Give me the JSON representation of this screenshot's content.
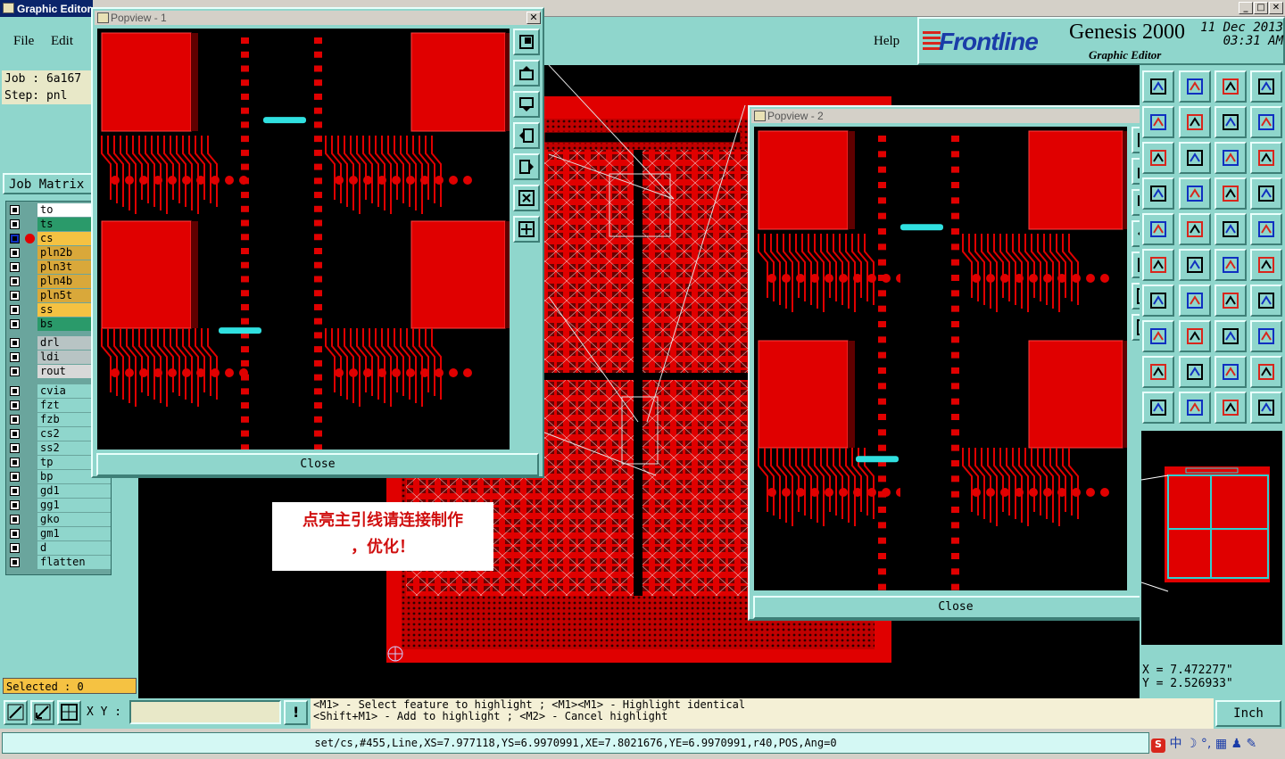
{
  "window": {
    "title": "Graphic Editor"
  },
  "menu": {
    "items": [
      "File",
      "Edit"
    ],
    "help": "Help"
  },
  "brand": {
    "logo": "Frontline",
    "product": "Genesis 2000",
    "subtitle": "Graphic Editor",
    "date": "11 Dec 2013",
    "time": "03:31 AM"
  },
  "job": {
    "job_label": "Job : 6a167",
    "step_label": "Step: pnl",
    "matrix_button": "Job Matrix"
  },
  "layers": [
    {
      "name": "to",
      "color": "#ffffff"
    },
    {
      "name": "ts",
      "color": "#2a9a6a"
    },
    {
      "name": "cs",
      "color": "#f5c242",
      "active": true
    },
    {
      "name": "pln2b",
      "color": "#d9a83a"
    },
    {
      "name": "pln3t",
      "color": "#d9a83a"
    },
    {
      "name": "pln4b",
      "color": "#d9a83a"
    },
    {
      "name": "pln5t",
      "color": "#d9a83a"
    },
    {
      "name": "ss",
      "color": "#f5c242"
    },
    {
      "name": "bs",
      "color": "#2a9a6a"
    },
    {
      "name": "drl",
      "color": "#b8c4c4"
    },
    {
      "name": "ldi",
      "color": "#b8c4c4"
    },
    {
      "name": "rout",
      "color": "#d8d8d8"
    },
    {
      "name": "cvia",
      "color": "#8fd6cc"
    },
    {
      "name": "fzt",
      "color": "#8fd6cc"
    },
    {
      "name": "fzb",
      "color": "#8fd6cc"
    },
    {
      "name": "cs2",
      "color": "#8fd6cc"
    },
    {
      "name": "ss2",
      "color": "#8fd6cc"
    },
    {
      "name": "tp",
      "color": "#8fd6cc"
    },
    {
      "name": "bp",
      "color": "#8fd6cc"
    },
    {
      "name": "gd1",
      "color": "#8fd6cc"
    },
    {
      "name": "gg1",
      "color": "#8fd6cc"
    },
    {
      "name": "gko",
      "color": "#8fd6cc"
    },
    {
      "name": "gm1",
      "color": "#8fd6cc"
    },
    {
      "name": "d",
      "color": "#8fd6cc"
    },
    {
      "name": "flatten",
      "color": "#8fd6cc"
    }
  ],
  "selection": {
    "label": "Selected : 0"
  },
  "popup1": {
    "title": "Popview - 1",
    "close": "Close"
  },
  "popup2": {
    "title": "Popview - 2",
    "close": "Close"
  },
  "annotation": {
    "line1": "点亮主引线请连接制作",
    "line2": "，优化！"
  },
  "coords": {
    "x": "X = 7.472277\"",
    "y": "Y = 2.526933\""
  },
  "input": {
    "xy_label": "X Y :",
    "value": ""
  },
  "hints": {
    "line1": "<M1> - Select feature to highlight ; <M1><M1> - Highlight identical",
    "line2": "<Shift+M1> - Add to highlight ; <M2> - Cancel highlight"
  },
  "units": {
    "label": "Inch"
  },
  "status": {
    "text": "set/cs,#455,Line,XS=7.977118,YS=6.9970991,XE=7.8021676,YE=6.9970991,r40,POS,Ang=0"
  },
  "tray": {
    "text": "中"
  }
}
